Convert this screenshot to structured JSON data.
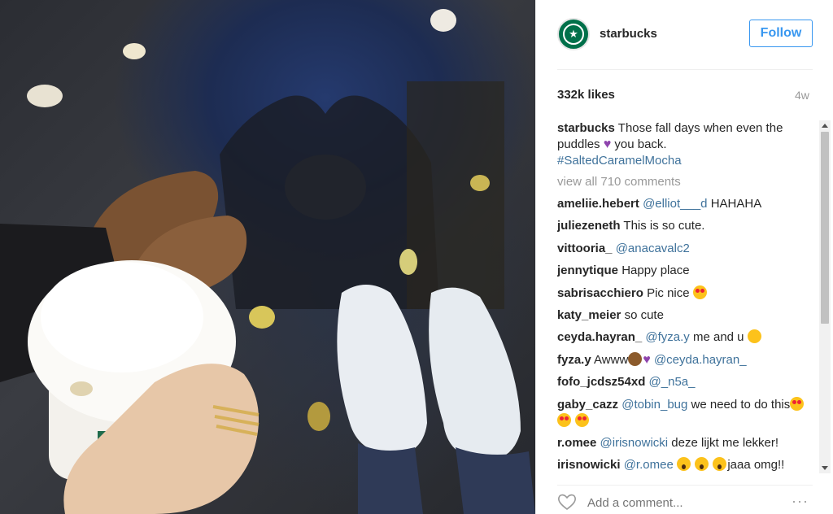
{
  "post": {
    "username": "starbucks",
    "follow_label": "Follow",
    "likes": "332k likes",
    "age": "4w",
    "caption": {
      "user": "starbucks",
      "text_before": "Those fall days when even the puddles",
      "text_after": "you back.",
      "hashtag": "#SaltedCaramelMocha"
    },
    "view_all": "view all 710 comments",
    "comments": [
      {
        "user": "ameliie.hebert",
        "mention": "@elliot___d",
        "text": "HAHAHA"
      },
      {
        "user": "juliezeneth",
        "text": "This is so cute."
      },
      {
        "user": "vittooria_",
        "mention": "@anacavalc2"
      },
      {
        "user": "jennytique",
        "text": "Happy place"
      },
      {
        "user": "sabrisacchiero",
        "text": "Pic nice"
      },
      {
        "user": "katy_meier",
        "text": "so cute"
      },
      {
        "user": "ceyda.hayran_",
        "mention": "@fyza.y",
        "text": "me and u"
      },
      {
        "user": "fyza.y",
        "text": "Awww",
        "mention2": "@ceyda.hayran_"
      },
      {
        "user": "fofo_jcdsz54xd",
        "mention": "@_n5a_"
      },
      {
        "user": "gaby_cazz",
        "mention": "@tobin_bug",
        "text": "we need to do this"
      },
      {
        "user": "r.omee",
        "mention": "@irisnowicki",
        "text": "deze lijkt me lekker!"
      },
      {
        "user": "irisnowicki",
        "mention": "@r.omee",
        "text": "jaaa omg!!"
      }
    ],
    "add_comment_placeholder": "Add a comment...",
    "more_label": "···"
  },
  "colors": {
    "link": "#3f729b",
    "follow": "#3897f0",
    "brand": "#00704a"
  }
}
